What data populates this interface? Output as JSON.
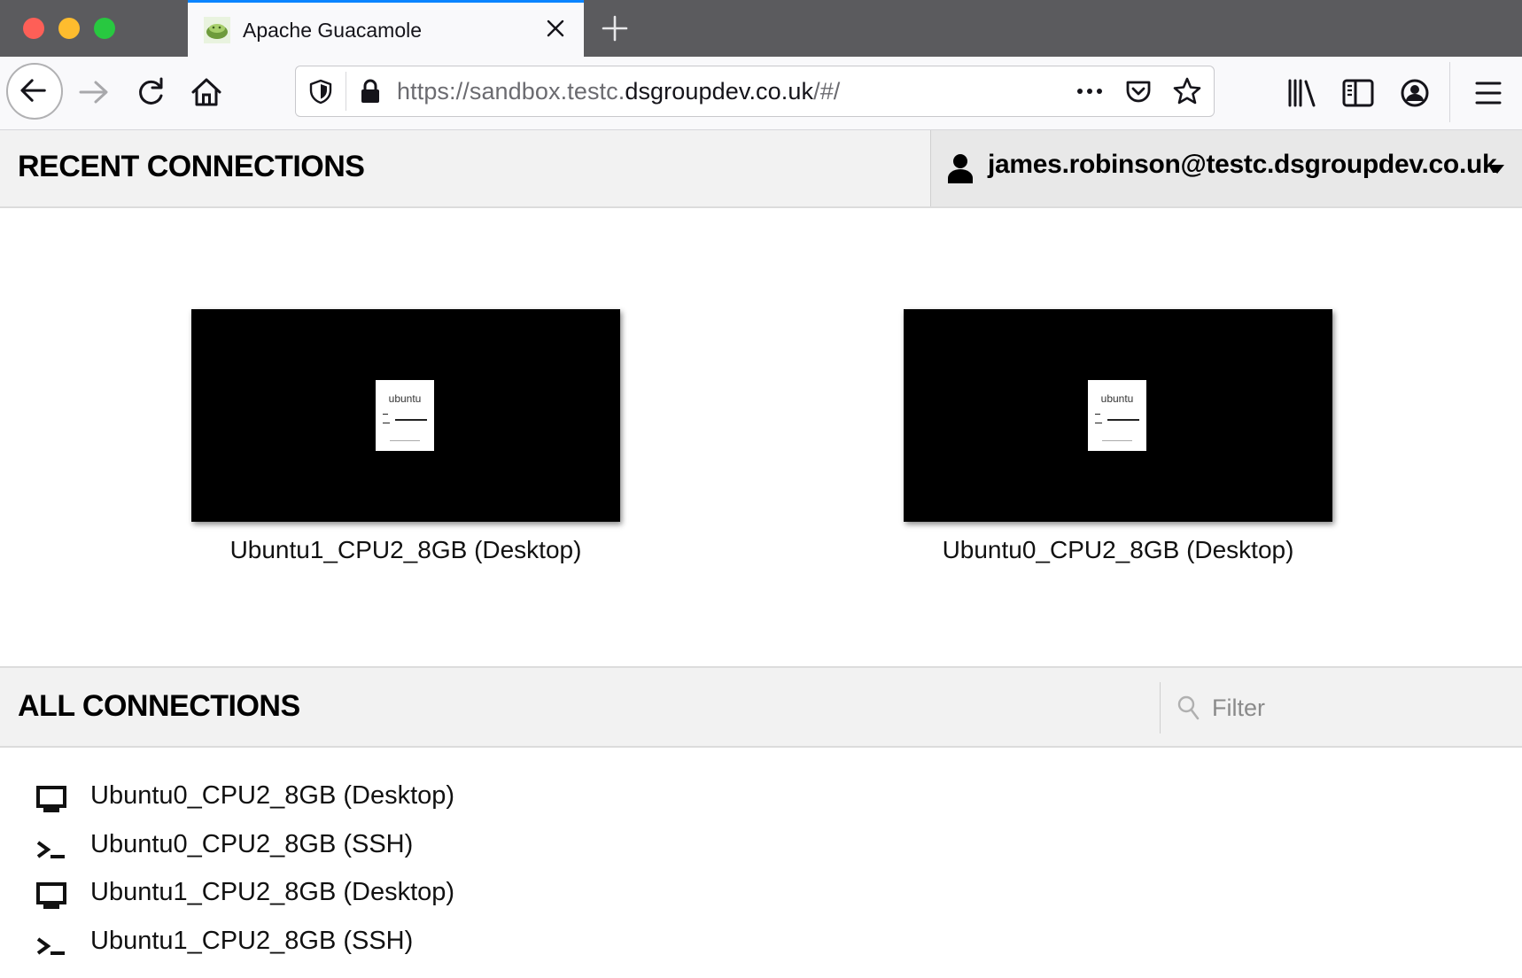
{
  "browser": {
    "tab": {
      "title": "Apache Guacamole",
      "favicon": "guacamole-favicon"
    },
    "url": {
      "dim_prefix": "https://sandbox.testc.",
      "domain": "dsgroupdev.co.uk",
      "path": "/#/"
    },
    "icons": [
      "back-icon",
      "forward-icon",
      "reload-icon",
      "home-icon",
      "shield-icon",
      "lock-icon",
      "more-icon",
      "pocket-icon",
      "star-icon",
      "library-icon",
      "sidebar-icon",
      "account-icon",
      "menu-icon",
      "close-icon",
      "plus-icon"
    ]
  },
  "recent": {
    "title": "RECENT CONNECTIONS",
    "items": [
      {
        "name": "Ubuntu1_CPU2_8GB (Desktop)",
        "thumbnail_text": "ubuntu"
      },
      {
        "name": "Ubuntu0_CPU2_8GB (Desktop)",
        "thumbnail_text": "ubuntu"
      }
    ]
  },
  "user": {
    "name": "james.robinson@testc.dsgroupdev.co.uk"
  },
  "all": {
    "title": "ALL CONNECTIONS",
    "filter": {
      "placeholder": "Filter",
      "value": ""
    },
    "items": [
      {
        "name": "Ubuntu0_CPU2_8GB (Desktop)",
        "icon": "desktop-icon"
      },
      {
        "name": "Ubuntu0_CPU2_8GB (SSH)",
        "icon": "terminal-icon"
      },
      {
        "name": "Ubuntu1_CPU2_8GB (Desktop)",
        "icon": "desktop-icon"
      },
      {
        "name": "Ubuntu1_CPU2_8GB (SSH)",
        "icon": "terminal-icon"
      }
    ]
  }
}
